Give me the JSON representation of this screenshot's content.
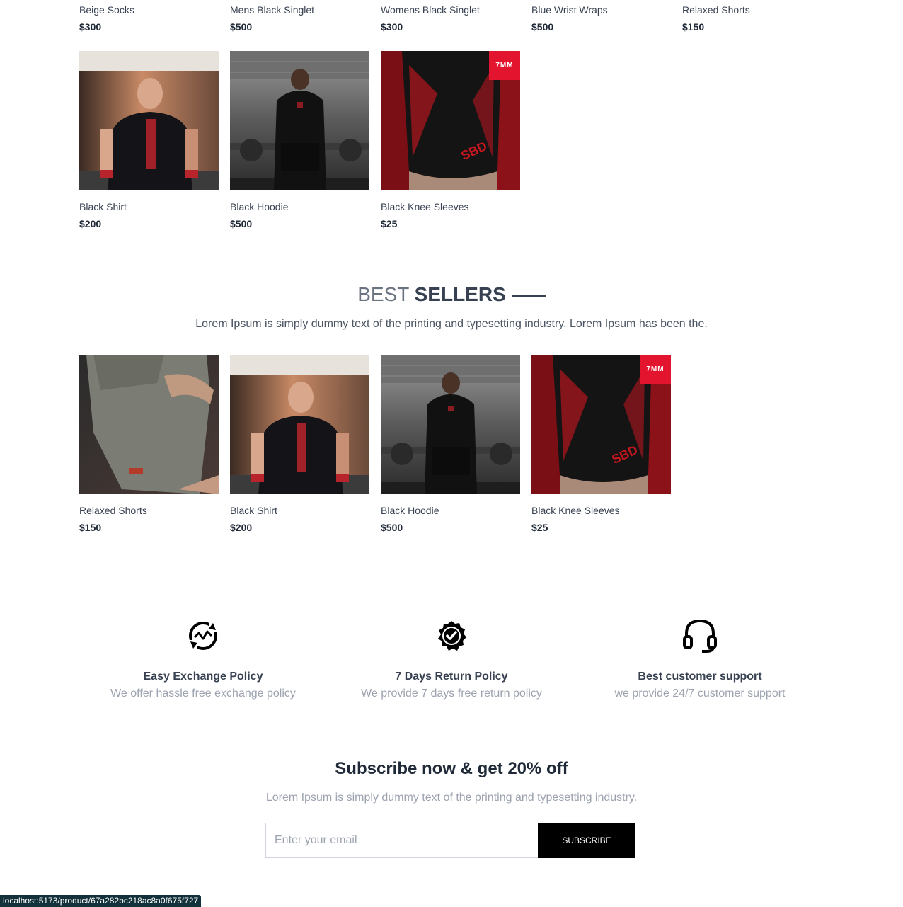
{
  "top_row": [
    {
      "name": "Beige Socks",
      "price": "$300"
    },
    {
      "name": "Mens Black Singlet",
      "price": "$500"
    },
    {
      "name": "Womens Black Singlet",
      "price": "$300"
    },
    {
      "name": "Blue Wrist Wraps",
      "price": "$500"
    },
    {
      "name": "Relaxed Shorts",
      "price": "$150"
    }
  ],
  "latest_row": [
    {
      "name": "Black Shirt",
      "price": "$200",
      "image": "black-shirt-image"
    },
    {
      "name": "Black Hoodie",
      "price": "$500",
      "image": "black-hoodie-image"
    },
    {
      "name": "Black Knee Sleeves",
      "price": "$25",
      "image": "knee-sleeves-image",
      "badge": "7MM"
    }
  ],
  "best_sellers": {
    "title_light": "BEST",
    "title_bold": "SELLERS",
    "description": "Lorem Ipsum is simply dummy text of the printing and typesetting industry. Lorem Ipsum has been the.",
    "items": [
      {
        "name": "Relaxed Shorts",
        "price": "$150",
        "image": "relaxed-shorts-image"
      },
      {
        "name": "Black Shirt",
        "price": "$200",
        "image": "black-shirt-image"
      },
      {
        "name": "Black Hoodie",
        "price": "$500",
        "image": "black-hoodie-image"
      },
      {
        "name": "Black Knee Sleeves",
        "price": "$25",
        "image": "knee-sleeves-image",
        "badge": "7MM"
      }
    ]
  },
  "policies": [
    {
      "icon": "exchange-icon",
      "title": "Easy Exchange Policy",
      "description": "We offer hassle free exchange policy"
    },
    {
      "icon": "quality-badge-icon",
      "title": "7 Days Return Policy",
      "description": "We provide 7 days free return policy"
    },
    {
      "icon": "headset-icon",
      "title": "Best customer support",
      "description": "we provide 24/7 customer support"
    }
  ],
  "subscribe": {
    "title": "Subscribe now & get 20% off",
    "description": "Lorem Ipsum is simply dummy text of the printing and typesetting industry.",
    "placeholder": "Enter your email",
    "button_label": "SUBSCRIBE"
  },
  "status_bar": {
    "url": "localhost:5173/product/67a282bc218ac8a0f675f727"
  },
  "colors": {
    "badge": "#e3142e",
    "button": "#000000",
    "status_bar": "#13313a"
  }
}
